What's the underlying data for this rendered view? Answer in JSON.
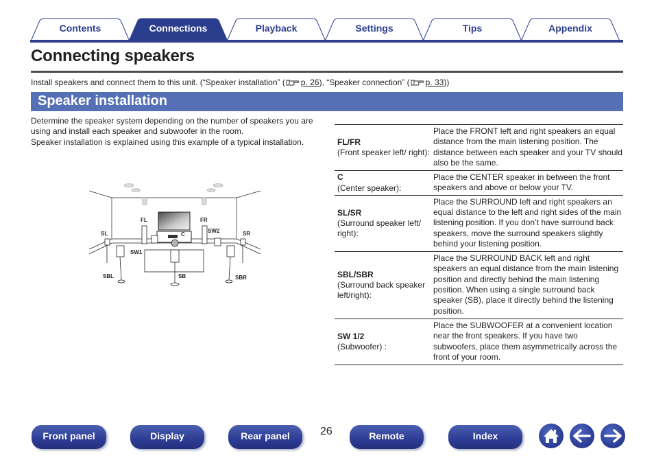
{
  "tabs": [
    {
      "label": "Contents",
      "active": false
    },
    {
      "label": "Connections",
      "active": true
    },
    {
      "label": "Playback",
      "active": false
    },
    {
      "label": "Settings",
      "active": false
    },
    {
      "label": "Tips",
      "active": false
    },
    {
      "label": "Appendix",
      "active": false
    }
  ],
  "colors": {
    "brand_blue": "#2b3e8e",
    "section_blue": "#5570b5",
    "text": "#231f20"
  },
  "page": {
    "title": "Connecting speakers",
    "intro": {
      "prefix": "Install speakers and connect them to this unit. (“Speaker installation” (",
      "ref1": "p. 26",
      "middle": "), “Speaker connection” (",
      "ref2": "p. 33",
      "suffix": "))",
      "ref_icon": "pointing-hand-icon"
    },
    "section_title": "Speaker installation",
    "body_lines": [
      "Determine the speaker system depending on the number of speakers you are using and install each speaker and subwoofer in the room.",
      "Speaker installation is explained using this example of a typical installation."
    ]
  },
  "diagram": {
    "labels": {
      "FL": "FL",
      "FR": "FR",
      "C": "C",
      "SL": "SL",
      "SR": "SR",
      "SW1": "SW1",
      "SW2": "SW2",
      "SBL": "SBL",
      "SB": "SB",
      "SBR": "SBR"
    }
  },
  "speaker_table": [
    {
      "code": "FL/FR",
      "name": "(Front speaker left/ right):",
      "description": "Place the FRONT left and right speakers an equal distance from the main listening position. The distance between each speaker and your TV should also be the same."
    },
    {
      "code": "C",
      "name": "(Center speaker):",
      "description": "Place the CENTER speaker in between the front speakers and above or below your TV."
    },
    {
      "code": "SL/SR",
      "name": "(Surround speaker left/ right):",
      "description": "Place the SURROUND left and right speakers an equal distance to the left and right sides of the main listening position. If you don’t have surround back speakers, move the surround speakers slightly behind your listening position."
    },
    {
      "code": "SBL/SBR",
      "name": "(Surround back speaker left/right):",
      "description": "Place the SURROUND BACK left and right speakers an equal distance from the main listening position and directly behind the main listening position. When using a single surround back speaker (SB), place it directly behind the listening position."
    },
    {
      "code": "SW 1/2",
      "name": "(Subwoofer) :",
      "description": "Place the SUBWOOFER at a convenient location near the front speakers. If you have two subwoofers, place them asymmetrically across the front of your room."
    }
  ],
  "footer": {
    "buttons": [
      {
        "label": "Front panel"
      },
      {
        "label": "Display"
      },
      {
        "label": "Rear panel"
      },
      {
        "label": "Remote"
      },
      {
        "label": "Index"
      }
    ],
    "page_number": "26",
    "icons": [
      "home-icon",
      "back-arrow-icon",
      "forward-arrow-icon"
    ]
  }
}
